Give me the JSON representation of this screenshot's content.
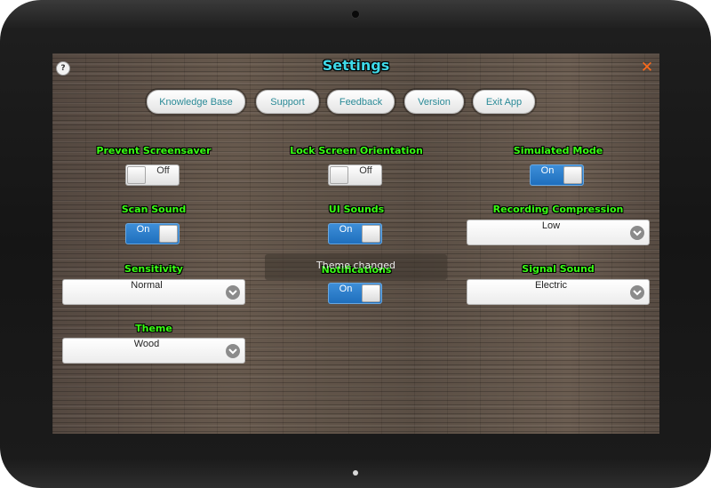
{
  "screen": {
    "title": "Settings"
  },
  "nav": [
    {
      "label": "Knowledge Base"
    },
    {
      "label": "Support"
    },
    {
      "label": "Feedback"
    },
    {
      "label": "Version"
    },
    {
      "label": "Exit App"
    }
  ],
  "settings": {
    "prevent_screensaver": {
      "label": "Prevent Screensaver",
      "value": "Off"
    },
    "lock_orientation": {
      "label": "Lock Screen Orientation",
      "value": "Off"
    },
    "simulated_mode": {
      "label": "Simulated Mode",
      "value": "On"
    },
    "scan_sound": {
      "label": "Scan Sound",
      "value": "On"
    },
    "ui_sounds": {
      "label": "UI Sounds",
      "value": "On"
    },
    "recording_compression": {
      "label": "Recording Compression",
      "value": "Low"
    },
    "sensitivity": {
      "label": "Sensitivity",
      "value": "Normal"
    },
    "notifications": {
      "label": "Notifications",
      "value": "On"
    },
    "signal_sound": {
      "label": "Signal Sound",
      "value": "Electric"
    },
    "theme": {
      "label": "Theme",
      "value": "Wood"
    }
  },
  "toast": {
    "message": "Theme changed"
  },
  "icons": {
    "help": "?",
    "close": "✕",
    "dropdown": "chevron-down"
  },
  "colors": {
    "title": "#3fd9e8",
    "label": "#39ff14",
    "toggle_on": "#2a7ccb",
    "nav_text": "#2a8a97",
    "close": "#ff6a1a"
  }
}
